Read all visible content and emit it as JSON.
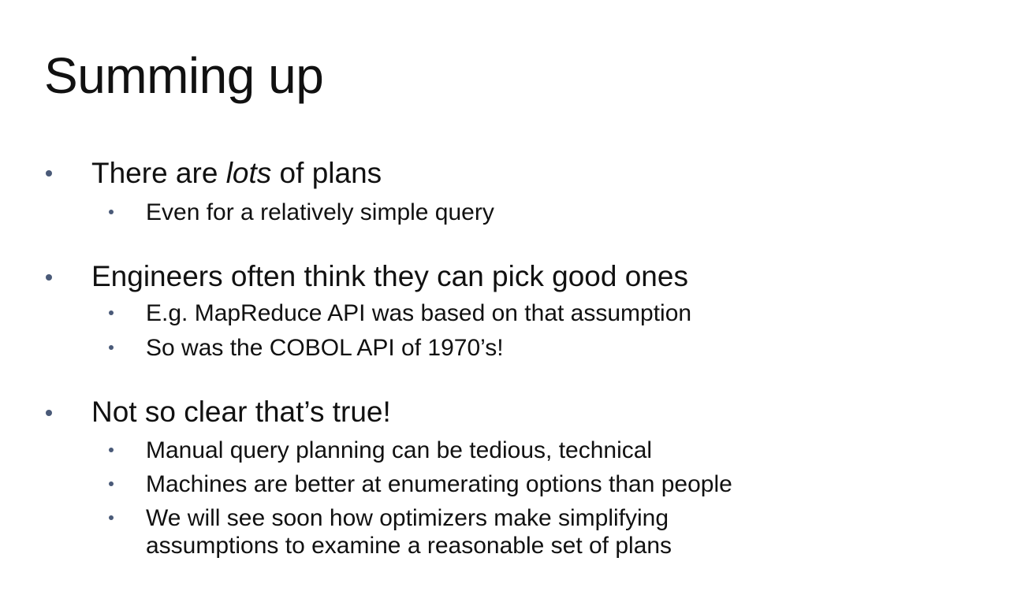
{
  "slide": {
    "title": "Summing up",
    "bullets": [
      {
        "pre": "There are ",
        "emph": "lots",
        "post": " of plans",
        "subs": [
          "Even for a relatively simple query"
        ]
      },
      {
        "text": "Engineers often think they can pick good ones",
        "subs": [
          "E.g. MapReduce API was based on that assumption",
          "So was the COBOL API of 1970’s!"
        ]
      },
      {
        "text": "Not so clear that’s true!",
        "subs": [
          "Manual query planning can be tedious, technical",
          "Machines are better at enumerating options than people",
          "We will see soon how optimizers make simplifying assumptions to examine a reasonable set of plans"
        ]
      }
    ]
  },
  "colors": {
    "text": "#111111",
    "bullet": "#4a5a78",
    "background": "#ffffff"
  }
}
